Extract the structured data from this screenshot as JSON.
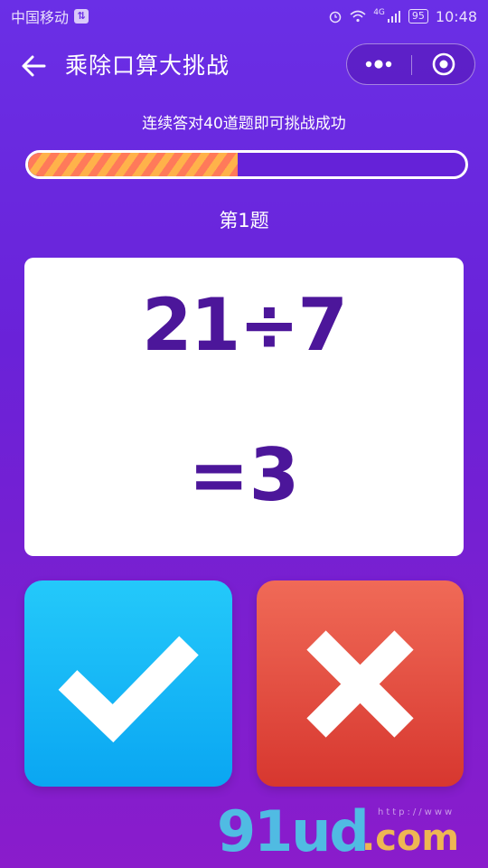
{
  "status_bar": {
    "carrier": "中国移动",
    "network": "4G",
    "battery": "95",
    "time": "10:48"
  },
  "nav": {
    "title": "乘除口算大挑战"
  },
  "progress": {
    "hint": "连续答对40道题即可挑战成功",
    "fill_percent": 48
  },
  "question": {
    "number_label": "第1题",
    "expression": "21÷7",
    "answer": "=3"
  },
  "buttons": {
    "correct_icon": "check-icon",
    "wrong_icon": "cross-icon"
  },
  "watermark": {
    "main": "91ud",
    "suffix": ".com",
    "small": "http://www"
  },
  "colors": {
    "background": "#6a2fe6",
    "question_text": "#4c169a",
    "correct_button": "#12b4f6",
    "wrong_button": "#e04a3d"
  }
}
